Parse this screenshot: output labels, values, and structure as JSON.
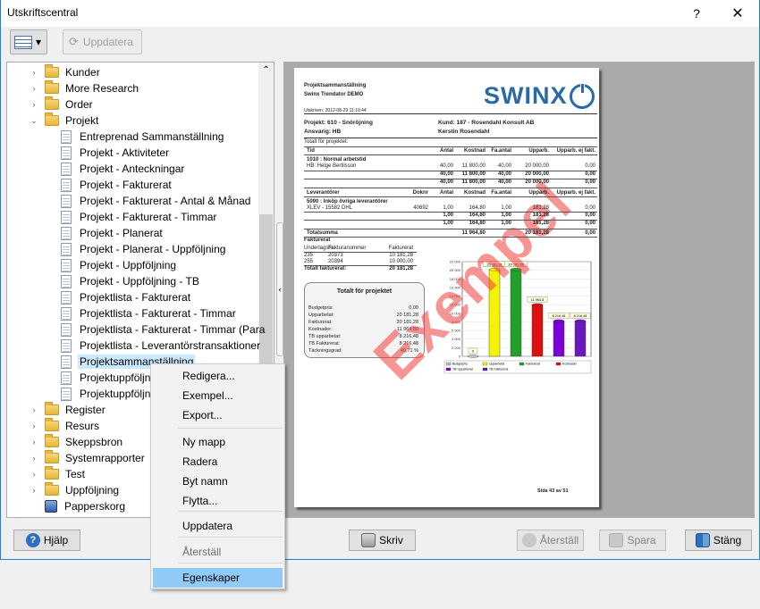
{
  "window": {
    "title": "Utskriftscentral",
    "help_glyph": "?",
    "close_glyph": "✕"
  },
  "toolbar": {
    "update_label": "Uppdatera",
    "view_dropdown_glyph": "▾"
  },
  "tree": {
    "items": [
      {
        "label": "Kunder",
        "type": "folder",
        "expander": "›"
      },
      {
        "label": "More Research",
        "type": "folder",
        "expander": "›"
      },
      {
        "label": "Order",
        "type": "folder",
        "expander": "›"
      },
      {
        "label": "Projekt",
        "type": "folder",
        "expander": "⌄"
      },
      {
        "label": "Entreprenad Sammanställning",
        "type": "doc"
      },
      {
        "label": "Projekt - Aktiviteter",
        "type": "doc"
      },
      {
        "label": "Projekt - Anteckningar",
        "type": "doc"
      },
      {
        "label": "Projekt - Fakturerat",
        "type": "doc"
      },
      {
        "label": "Projekt - Fakturerat - Antal & Månad",
        "type": "doc"
      },
      {
        "label": "Projekt - Fakturerat - Timmar",
        "type": "doc"
      },
      {
        "label": "Projekt - Planerat",
        "type": "doc"
      },
      {
        "label": "Projekt - Planerat - Uppföljning",
        "type": "doc"
      },
      {
        "label": "Projekt - Uppföljning",
        "type": "doc"
      },
      {
        "label": "Projekt - Uppföljning - TB",
        "type": "doc"
      },
      {
        "label": "Projektlista - Fakturerat",
        "type": "doc"
      },
      {
        "label": "Projektlista - Fakturerat - Timmar",
        "type": "doc"
      },
      {
        "label": "Projektlista - Fakturerat - Timmar (Para",
        "type": "doc"
      },
      {
        "label": "Projektlista - Leverantörstransaktioner",
        "type": "doc"
      },
      {
        "label": "Projektsammanställning",
        "type": "doc",
        "selected": true
      },
      {
        "label": "Projektuppföljning",
        "type": "doc"
      },
      {
        "label": "Projektuppföljning",
        "type": "doc"
      },
      {
        "label": "Register",
        "type": "folder",
        "expander": "›"
      },
      {
        "label": "Resurs",
        "type": "folder",
        "expander": "›"
      },
      {
        "label": "Skeppsbron",
        "type": "folder",
        "expander": "›"
      },
      {
        "label": "Systemrapporter",
        "type": "folder",
        "expander": "›"
      },
      {
        "label": "Test",
        "type": "folder",
        "expander": "›"
      },
      {
        "label": "Uppföljning",
        "type": "folder",
        "expander": "›"
      },
      {
        "label": "Papperskorg",
        "type": "trash"
      }
    ]
  },
  "context_menu": {
    "items": [
      {
        "label": "Redigera...",
        "enabled": true
      },
      {
        "label": "Exempel...",
        "enabled": true
      },
      {
        "label": "Export...",
        "enabled": true
      },
      {
        "label": "Ny mapp",
        "enabled": true
      },
      {
        "label": "Radera",
        "enabled": true
      },
      {
        "label": "Byt namn",
        "enabled": true
      },
      {
        "label": "Flytta...",
        "enabled": true
      },
      {
        "label": "Uppdatera",
        "enabled": true
      },
      {
        "label": "Återställ",
        "enabled": false
      },
      {
        "label": "Egenskaper",
        "enabled": true,
        "highlighted": true
      }
    ]
  },
  "preview": {
    "heading": "Projektsammanställning",
    "company": "Swinx Trendator DEMO",
    "printed": "Utskriven: 2012-08-29 11:10:44",
    "logo_text": "SWINX",
    "project": "Projekt: 610 - Snöröjning",
    "customer": "Kund: 187 - Rosendahl Konsult AB",
    "responsible_left": "Ansvarig: HB",
    "responsible_right": "Kerstin Rosendahl",
    "total_label": "Totalt för projektet:",
    "time_header": [
      "Tid",
      "Antal",
      "Kostnad",
      "Fa.antal",
      "Upparb.",
      "Upparb. ej fakt."
    ],
    "time_group": "1010 : Normal arbetstid",
    "time_row": [
      "HB: Helge Bertilsson",
      "40,00",
      "11 800,00",
      "40,00",
      "20 000,00",
      "0,00"
    ],
    "time_sub1": [
      "40,00",
      "11 800,00",
      "40,00",
      "20 000,00",
      "0,00"
    ],
    "time_sub2": [
      "40,00",
      "11 800,00",
      "40,00",
      "20 000,00",
      "0,00"
    ],
    "supplier_header": [
      "Leverantörer",
      "Doknr",
      "Antal",
      "Kostnad",
      "Fa.antal",
      "Upparb.",
      "Upparb. ej fakt."
    ],
    "supplier_group": "5090 : Inköp övriga leverantörer",
    "supplier_row": [
      "XLEV - 15582  DHL",
      "40692",
      "1,00",
      "164,80",
      "1,00",
      "181,28",
      "0,00"
    ],
    "supplier_sub1": [
      "1,00",
      "164,80",
      "1,00",
      "181,28",
      "0,00"
    ],
    "supplier_sub2": [
      "1,00",
      "164,80",
      "1,00",
      "181,28",
      "0,00"
    ],
    "totalsumma": [
      "Totalsumma",
      "11 964,80",
      "20 181,28",
      "0,00"
    ],
    "invoiced_title": "Fakturerat",
    "invoiced_header": [
      "Underlagsnr.",
      "Fakturanummer",
      "Fakturerat"
    ],
    "invoiced_rows": [
      [
        "235",
        "20373",
        "10 181,28"
      ],
      [
        "255",
        "20394",
        "10 000,00"
      ]
    ],
    "invoiced_total": [
      "Totalt fakturerat:",
      "20 181,28"
    ],
    "summary_title": "Totalt för projektet",
    "summary_rows": [
      [
        "Budgetpris:",
        "0,00"
      ],
      [
        "Upparbetat:",
        "20 181,28"
      ],
      [
        "Fakturerat:",
        "20 181,28"
      ],
      [
        "Kostnader:",
        "11 964,80"
      ],
      [
        "TB upparbetat:",
        "8 216,48"
      ],
      [
        "TB Fakturerat:",
        "8 216,48"
      ],
      [
        "Täckningsgrad:",
        "40,71 %"
      ]
    ],
    "watermark": "Exempel",
    "page_number": "Sida 43 av 51"
  },
  "chart_data": {
    "type": "bar",
    "categories": [
      "Budgetpris",
      "Upparbetat",
      "Fakturerat",
      "Kostnader",
      "TB Upparbetat",
      "TB Fakturerat"
    ],
    "values": [
      0,
      20181.28,
      20181.28,
      11964.8,
      8216.48,
      8216.48
    ],
    "value_labels": [
      "0",
      "20 181,28",
      "20 181,28",
      "11 964,8",
      "8 216,48",
      "8 216,48"
    ],
    "colors": [
      "#c0c0c0",
      "#f4f400",
      "#22a02a",
      "#e01010",
      "#7a00d8",
      "#6a18c0"
    ],
    "yticks": [
      "0",
      "2 000",
      "4 000",
      "6 000",
      "8 000",
      "10 000",
      "12 000",
      "14 000",
      "16 000",
      "18 000",
      "20 000",
      "22 000"
    ],
    "ylim": [
      0,
      22000
    ]
  },
  "buttons": {
    "help": "Hjälp",
    "print": "Skriv",
    "restore": "Återställ",
    "save": "Spara",
    "close": "Stäng"
  }
}
